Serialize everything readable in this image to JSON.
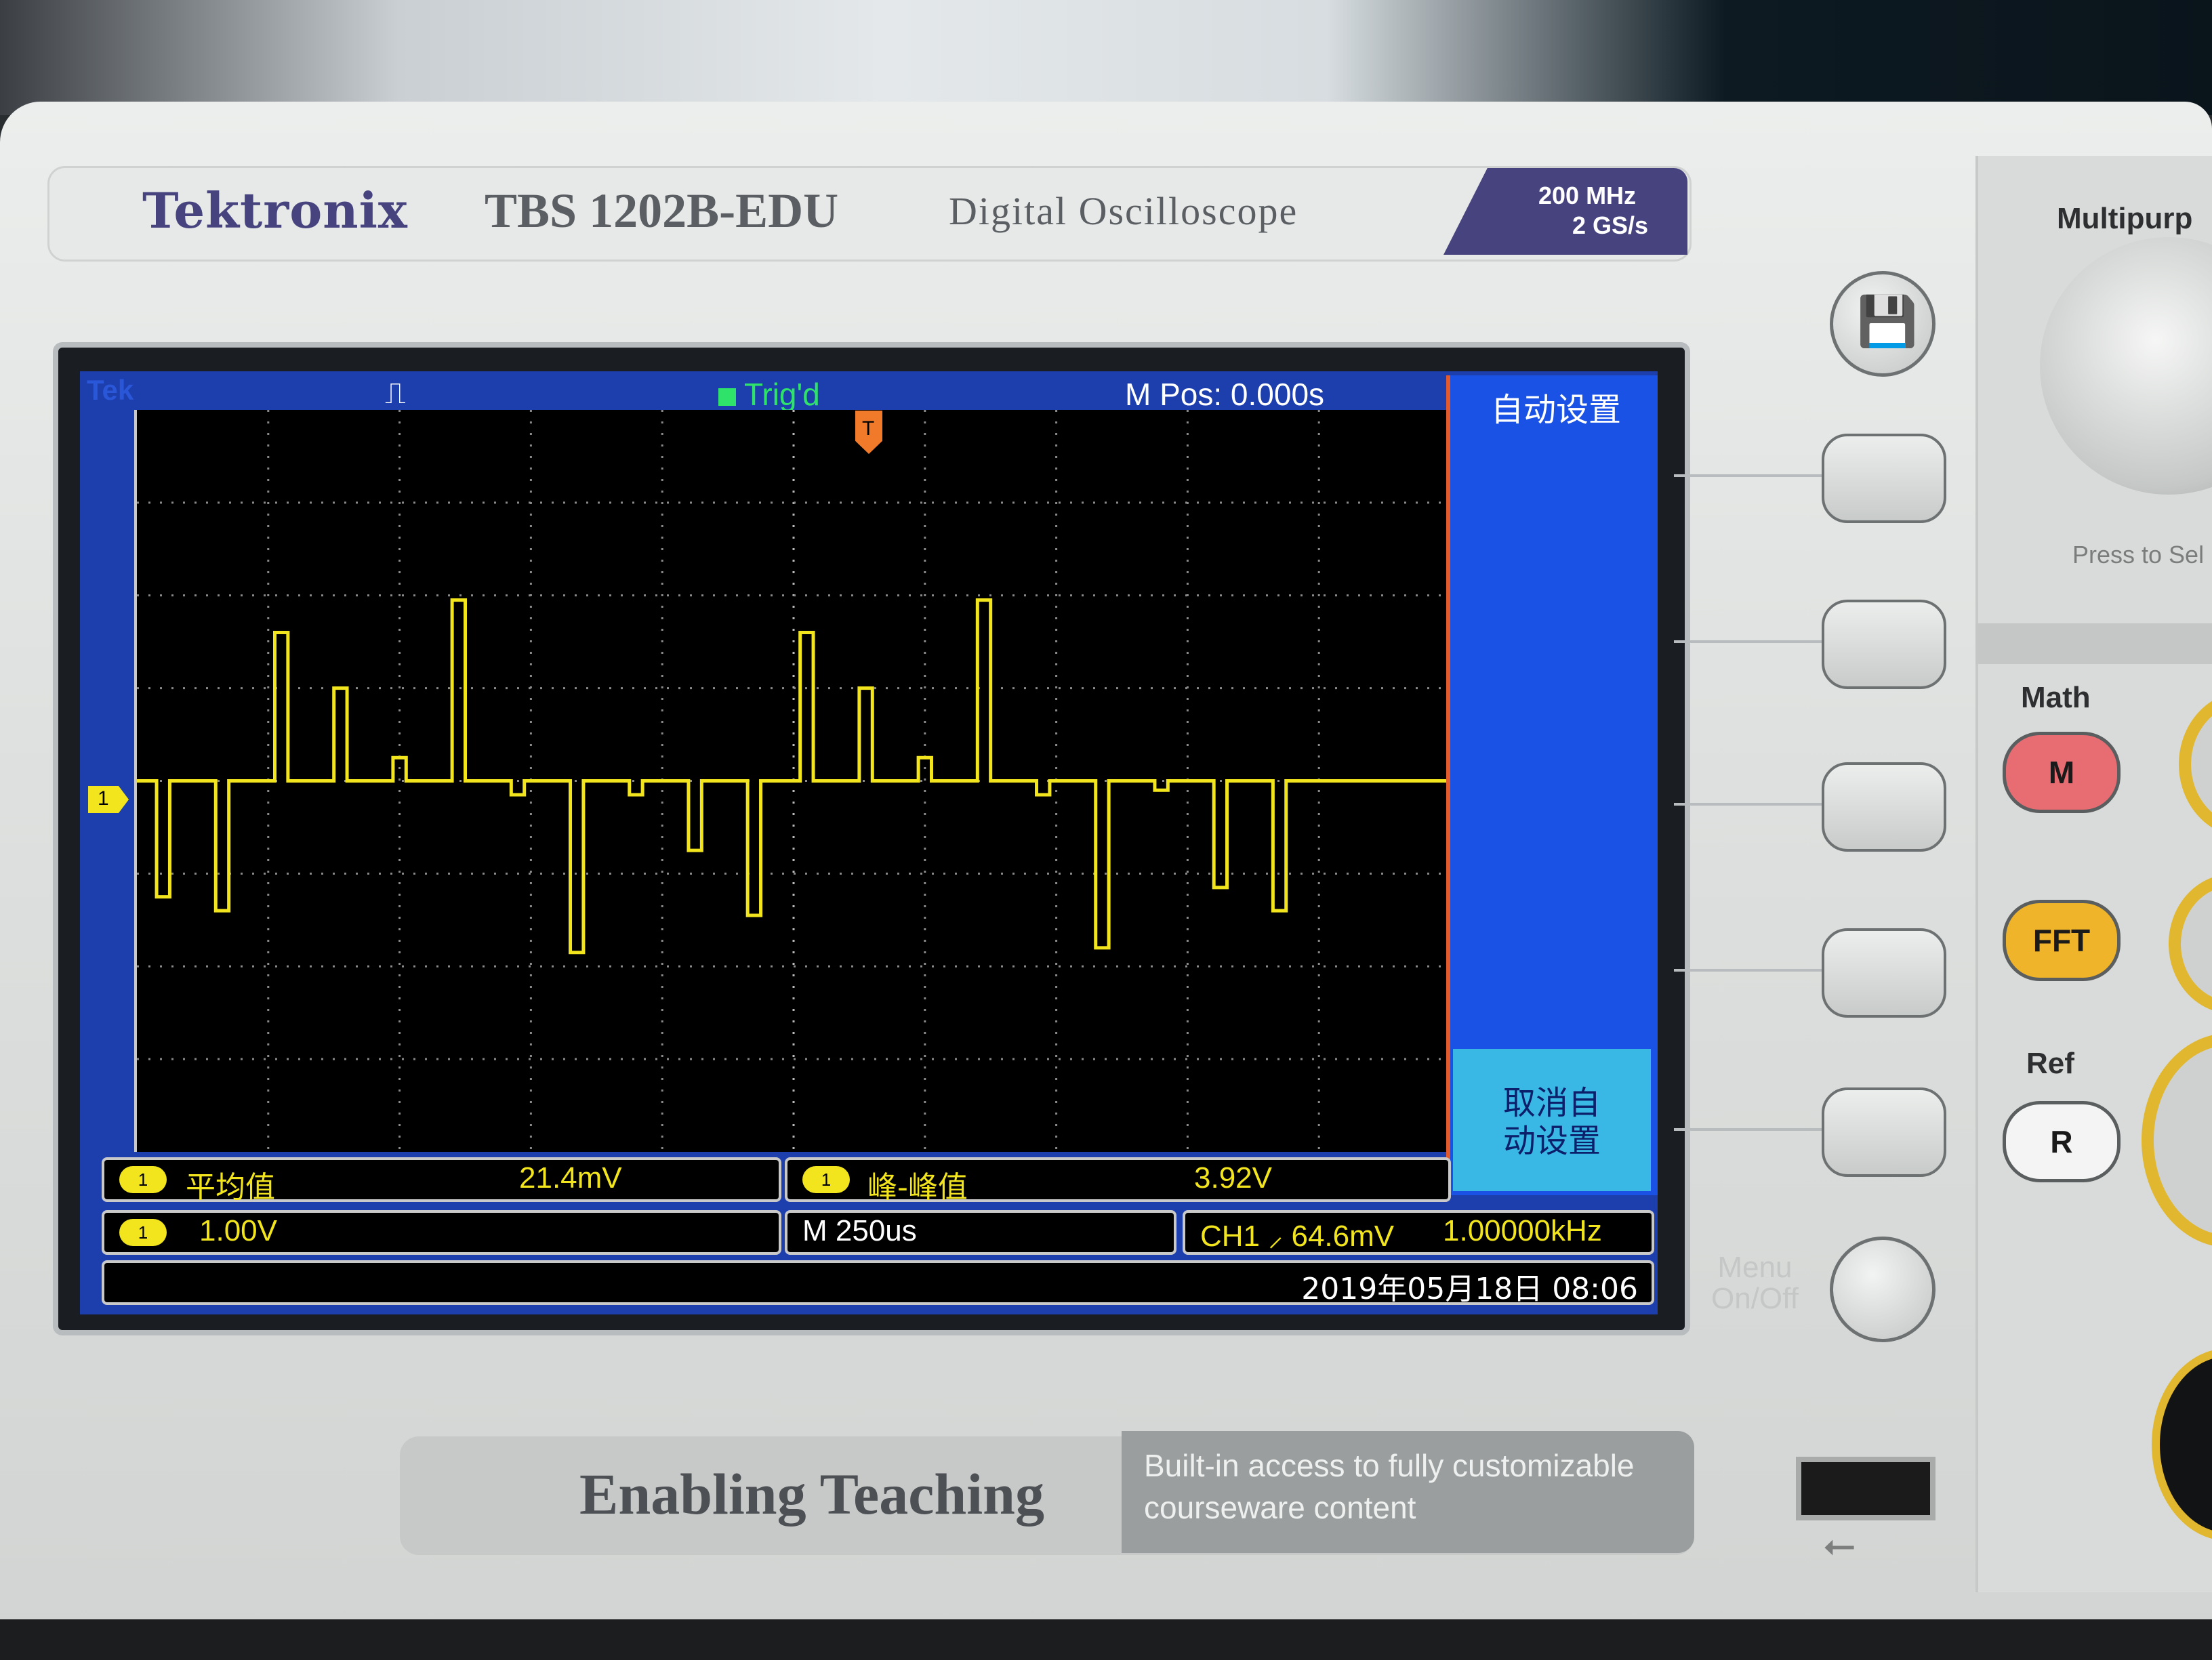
{
  "header": {
    "brand": "Tektronix",
    "model": "TBS 1202B-EDU",
    "description": "Digital Oscilloscope",
    "bandwidth": "200 MHz",
    "sample_rate": "2 GS/s"
  },
  "screen": {
    "tek_label": "Tek",
    "acquire_icon": "pulse-icon",
    "trigger_status": "Trig'd",
    "horizontal_position": "M Pos: 0.000s",
    "menu": {
      "title": "自动设置",
      "cancel_label": "取消自\n动设置"
    },
    "measurements": [
      {
        "channel": "1",
        "label": "平均值",
        "value": "21.4mV"
      },
      {
        "channel": "1",
        "label": "峰-峰值",
        "value": "3.92V"
      }
    ],
    "channel_scale": {
      "channel": "1",
      "value": "1.00V"
    },
    "timebase": "M 250us",
    "trigger_readout": "CH1 ⸝ 64.6mV",
    "frequency": "1.00000kHz",
    "datetime": "2019年05月18日 08:06",
    "ground_marker": "1",
    "trigger_marker": "T",
    "trace_color": "#f2e51d"
  },
  "panel": {
    "multipurpose_label": "Multipurp",
    "press_hint": "Press to Sel",
    "math_label": "Math",
    "math_button": "M",
    "fft_button": "FFT",
    "ref_label": "Ref",
    "ref_button": "R",
    "menu_onoff": "Menu\nOn/Off",
    "save_icon": "floppy-icon"
  },
  "footer": {
    "title": "Enabling Teaching",
    "subtitle": "Built-in access to fully customizable\ncourseware content"
  },
  "chart_data": {
    "type": "line",
    "title": "",
    "xlabel": "",
    "ylabel": "",
    "x_divisions": 10,
    "y_divisions": 8,
    "timebase": "250us/div",
    "volts_per_div": 1.0,
    "series": [
      {
        "name": "",
        "color": "#f2e51d",
        "pulses": [
          {
            "t_div": 0.15,
            "w_div": 0.1,
            "v": -1.25
          },
          {
            "t_div": 0.6,
            "w_div": 0.1,
            "v": -1.4
          },
          {
            "t_div": 1.05,
            "w_div": 0.1,
            "v": 1.6
          },
          {
            "t_div": 1.5,
            "w_div": 0.1,
            "v": 1.0
          },
          {
            "t_div": 1.95,
            "w_div": 0.1,
            "v": 0.25
          },
          {
            "t_div": 2.4,
            "w_div": 0.1,
            "v": 1.95
          },
          {
            "t_div": 2.85,
            "w_div": 0.1,
            "v": -0.15
          },
          {
            "t_div": 3.3,
            "w_div": 0.1,
            "v": -1.85
          },
          {
            "t_div": 3.75,
            "w_div": 0.1,
            "v": -0.15
          },
          {
            "t_div": 4.2,
            "w_div": 0.1,
            "v": -0.75
          },
          {
            "t_div": 4.65,
            "w_div": 0.1,
            "v": -1.45
          },
          {
            "t_div": 5.05,
            "w_div": 0.1,
            "v": 1.6
          },
          {
            "t_div": 5.5,
            "w_div": 0.1,
            "v": 1.0
          },
          {
            "t_div": 5.95,
            "w_div": 0.1,
            "v": 0.25
          },
          {
            "t_div": 6.4,
            "w_div": 0.1,
            "v": 1.95
          },
          {
            "t_div": 6.85,
            "w_div": 0.1,
            "v": -0.15
          },
          {
            "t_div": 7.3,
            "w_div": 0.1,
            "v": -1.8
          },
          {
            "t_div": 7.75,
            "w_div": 0.1,
            "v": -0.1
          },
          {
            "t_div": 8.2,
            "w_div": 0.1,
            "v": -1.15
          },
          {
            "t_div": 8.65,
            "w_div": 0.1,
            "v": -1.4
          }
        ]
      }
    ]
  }
}
